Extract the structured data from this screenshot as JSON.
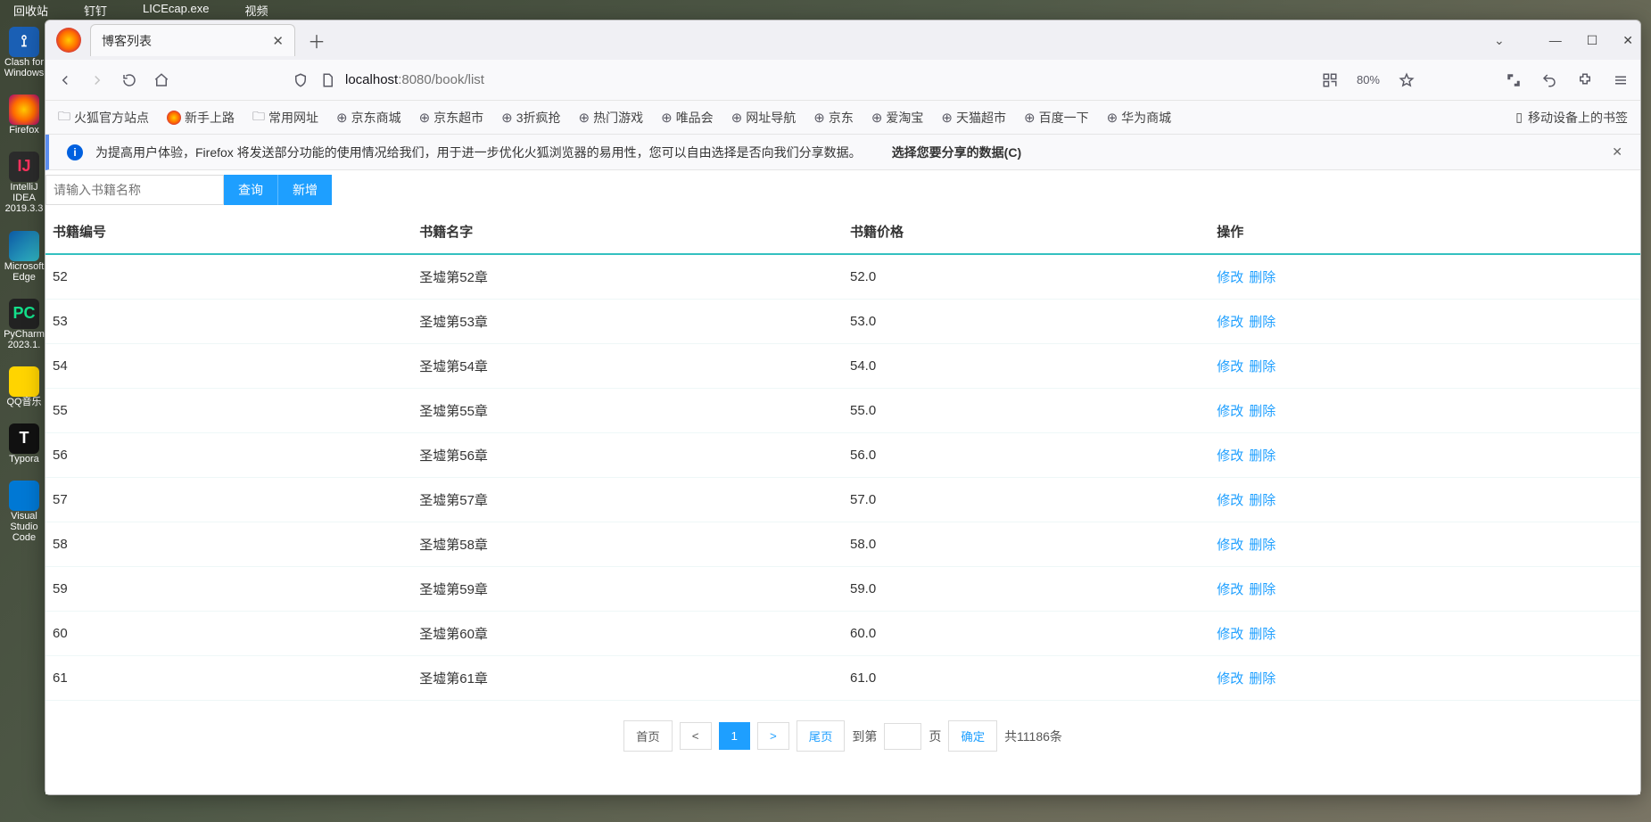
{
  "desktop": {
    "topbar": [
      "回收站",
      "钉钉",
      "LICEcap.exe",
      "视频"
    ],
    "icons": [
      {
        "label": "Clash for Windows",
        "cls": "ico-clash",
        "glyph": "⟟"
      },
      {
        "label": "Firefox",
        "cls": "ico-firefox",
        "glyph": ""
      },
      {
        "label": "IntelliJ IDEA 2019.3.3",
        "cls": "ico-ij",
        "glyph": "IJ"
      },
      {
        "label": "Microsoft Edge",
        "cls": "ico-edge",
        "glyph": ""
      },
      {
        "label": "PyCharm 2023.1.",
        "cls": "ico-pc",
        "glyph": "PC"
      },
      {
        "label": "QQ音乐",
        "cls": "ico-qq",
        "glyph": ""
      },
      {
        "label": "Typora",
        "cls": "ico-ty",
        "glyph": "T"
      },
      {
        "label": "Visual Studio Code",
        "cls": "ico-vs",
        "glyph": ""
      }
    ]
  },
  "browser": {
    "tab_title": "博客列表",
    "url_host": "localhost",
    "url_port": ":8080",
    "url_path": "/book/list",
    "zoom": "80%",
    "bookmarks": [
      {
        "icon": "folder",
        "label": "火狐官方站点"
      },
      {
        "icon": "ff",
        "label": "新手上路"
      },
      {
        "icon": "folder",
        "label": "常用网址"
      },
      {
        "icon": "globe",
        "label": "京东商城"
      },
      {
        "icon": "globe",
        "label": "京东超市"
      },
      {
        "icon": "globe",
        "label": "3折疯抢"
      },
      {
        "icon": "globe",
        "label": "热门游戏"
      },
      {
        "icon": "globe",
        "label": "唯品会"
      },
      {
        "icon": "globe",
        "label": "网址导航"
      },
      {
        "icon": "globe",
        "label": "京东"
      },
      {
        "icon": "globe",
        "label": "爱淘宝"
      },
      {
        "icon": "globe",
        "label": "天猫超市"
      },
      {
        "icon": "globe",
        "label": "百度一下"
      },
      {
        "icon": "globe",
        "label": "华为商城"
      }
    ],
    "bm_right": "移动设备上的书签",
    "infobar_text": "为提高用户体验，Firefox 将发送部分功能的使用情况给我们，用于进一步优化火狐浏览器的易用性，您可以自由选择是否向我们分享数据。",
    "infobar_action": "选择您要分享的数据(C)"
  },
  "page": {
    "search_placeholder": "请输入书籍名称",
    "search_value": "",
    "btn_query": "查询",
    "btn_add": "新增",
    "columns": [
      "书籍编号",
      "书籍名字",
      "书籍价格",
      "操作"
    ],
    "op_edit": "修改",
    "op_del": "删除",
    "rows": [
      {
        "id": "52",
        "name": "圣墟第52章",
        "price": "52.0"
      },
      {
        "id": "53",
        "name": "圣墟第53章",
        "price": "53.0"
      },
      {
        "id": "54",
        "name": "圣墟第54章",
        "price": "54.0"
      },
      {
        "id": "55",
        "name": "圣墟第55章",
        "price": "55.0"
      },
      {
        "id": "56",
        "name": "圣墟第56章",
        "price": "56.0"
      },
      {
        "id": "57",
        "name": "圣墟第57章",
        "price": "57.0"
      },
      {
        "id": "58",
        "name": "圣墟第58章",
        "price": "58.0"
      },
      {
        "id": "59",
        "name": "圣墟第59章",
        "price": "59.0"
      },
      {
        "id": "60",
        "name": "圣墟第60章",
        "price": "60.0"
      },
      {
        "id": "61",
        "name": "圣墟第61章",
        "price": "61.0"
      }
    ],
    "pager": {
      "first": "首页",
      "prev": "<",
      "current": "1",
      "next": ">",
      "last": "尾页",
      "goto_prefix": "到第",
      "goto_suffix": "页",
      "confirm": "确定",
      "total": "共11186条"
    }
  }
}
